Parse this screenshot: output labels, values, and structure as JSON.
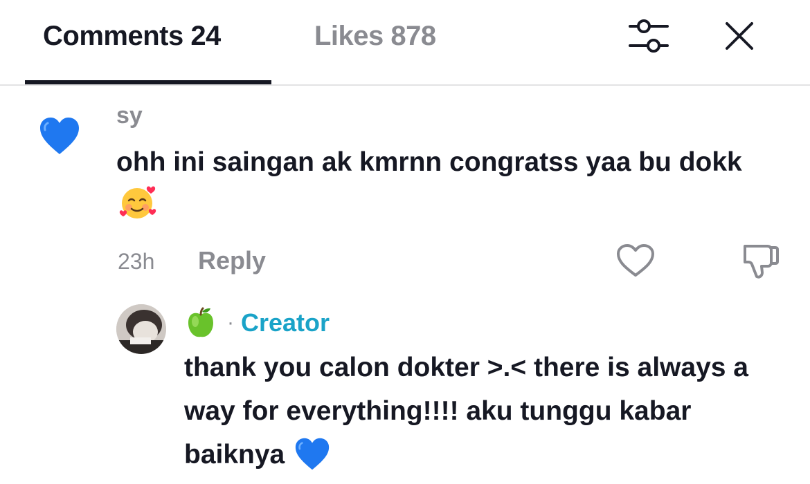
{
  "tabs": {
    "comments_label": "Comments 24",
    "likes_label": "Likes 878"
  },
  "header": {
    "filter_icon": "sliders-icon",
    "close_icon": "close-icon"
  },
  "comment": {
    "avatar_icon": "blue-heart-icon",
    "username": "sy",
    "text": "ohh ini saingan ak kmrnn congratss yaa bu dokk",
    "text_emoji": "smiling-face-with-hearts-emoji",
    "time": "23h",
    "reply_label": "Reply",
    "like_icon": "heart-outline-icon",
    "dislike_icon": "thumbs-down-icon"
  },
  "reply": {
    "user_emoji": "green-apple-emoji",
    "separator": "·",
    "creator_label": "Creator",
    "text": "thank you calon dokter >.< there is always a way for everything!!!! aku tunggu kabar baiknya",
    "text_emoji": "blue-heart-emoji"
  },
  "colors": {
    "primary_text": "#161823",
    "secondary_text": "#8a8b91",
    "creator_accent": "#1aa3c8",
    "heart_blue": "#1f78f0",
    "divider": "#e3e3e4"
  }
}
